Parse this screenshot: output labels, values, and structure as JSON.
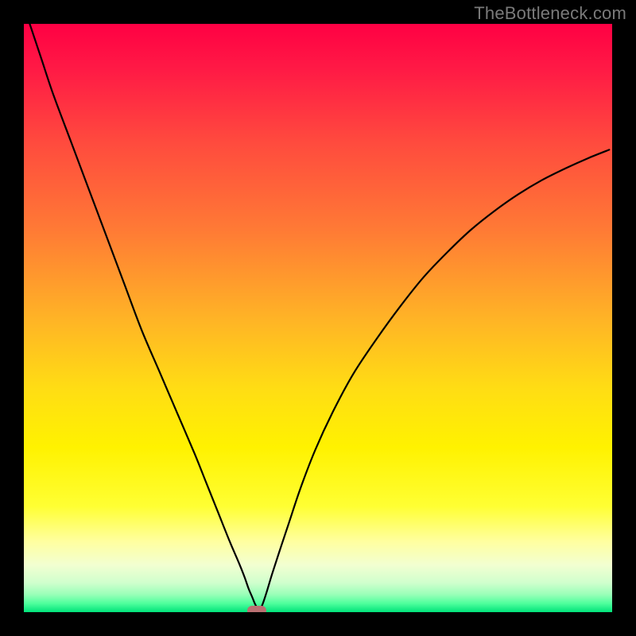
{
  "attribution": "TheBottleneck.com",
  "chart_data": {
    "type": "line",
    "title": "",
    "xlabel": "",
    "ylabel": "",
    "x_range": [
      0,
      100
    ],
    "y_range": [
      0,
      100
    ],
    "gradient_stops": [
      {
        "offset": 0.0,
        "color": "#ff0044"
      },
      {
        "offset": 0.08,
        "color": "#ff1b45"
      },
      {
        "offset": 0.2,
        "color": "#ff4a3e"
      },
      {
        "offset": 0.35,
        "color": "#ff7a35"
      },
      {
        "offset": 0.5,
        "color": "#ffb326"
      },
      {
        "offset": 0.62,
        "color": "#ffdd14"
      },
      {
        "offset": 0.72,
        "color": "#fff200"
      },
      {
        "offset": 0.82,
        "color": "#ffff33"
      },
      {
        "offset": 0.88,
        "color": "#ffffa0"
      },
      {
        "offset": 0.92,
        "color": "#f2ffd1"
      },
      {
        "offset": 0.95,
        "color": "#d0ffcd"
      },
      {
        "offset": 0.97,
        "color": "#99ffb8"
      },
      {
        "offset": 0.985,
        "color": "#4fff9d"
      },
      {
        "offset": 1.0,
        "color": "#00e37a"
      }
    ],
    "series": [
      {
        "name": "bottleneck-curve-left",
        "x": [
          1,
          3,
          5,
          8,
          11,
          14,
          17,
          20,
          23,
          26,
          29,
          31,
          33,
          35,
          36.5,
          37.5,
          38.2,
          38.8,
          39.2,
          39.6,
          40.0
        ],
        "y": [
          100,
          94,
          88,
          80,
          72,
          64,
          56,
          48,
          41,
          34,
          27,
          22,
          17,
          12,
          8.5,
          6.0,
          4.0,
          2.6,
          1.6,
          0.8,
          0.1
        ]
      },
      {
        "name": "bottleneck-curve-right",
        "x": [
          40.0,
          40.6,
          41.3,
          42.2,
          43.5,
          45,
          47,
          49.5,
          52.5,
          56,
          60,
          64,
          68,
          72,
          76,
          80,
          84,
          88,
          92,
          96,
          99.5
        ],
        "y": [
          0.1,
          1.4,
          3.5,
          6.5,
          10.5,
          15,
          21,
          27.5,
          34,
          40.5,
          46.5,
          52,
          57,
          61.2,
          65,
          68.2,
          71,
          73.4,
          75.4,
          77.2,
          78.6
        ]
      }
    ],
    "marker": {
      "name": "optimum-point",
      "x": 39.6,
      "y": 0.3,
      "w": 3.2,
      "h": 1.6,
      "color": "#ba7072"
    }
  }
}
